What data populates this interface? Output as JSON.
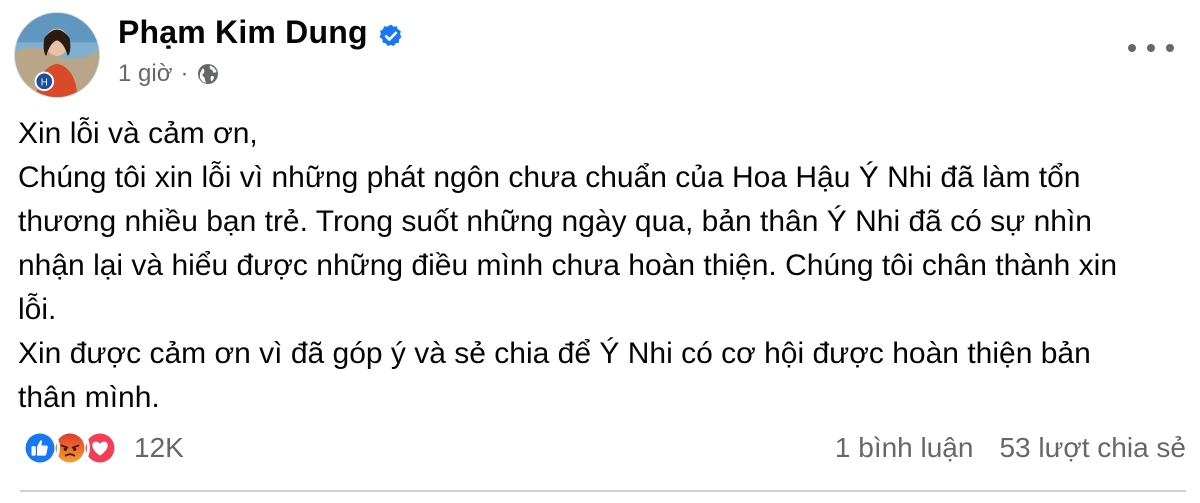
{
  "post": {
    "author_name": "Phạm Kim Dung",
    "time": "1 giờ",
    "separator": "·",
    "icons": {
      "verified": "verified-badge-icon",
      "privacy": "globe-icon",
      "more": "more-options-icon"
    },
    "text_lines": [
      "Xin lỗi và cảm ơn,",
      "Chúng tôi xin lỗi vì những phát ngôn chưa chuẩn của Hoa Hậu Ý Nhi đã làm tổn",
      "thương nhiều bạn trẻ. Trong suốt những ngày qua, bản thân Ý Nhi đã có sự nhìn",
      "nhận lại và hiểu được những điều mình chưa hoàn thiện. Chúng tôi chân thành xin",
      "lỗi.",
      "Xin được cảm ơn vì đã góp ý và sẻ chia để Ý Nhi có cơ hội được hoàn thiện bản",
      "thân mình."
    ]
  },
  "engagement": {
    "reactions": [
      "like",
      "angry",
      "love"
    ],
    "reaction_count": "12K",
    "comments": "1 bình luận",
    "shares": "53 lượt chia sẻ"
  },
  "colors": {
    "text": "#050505",
    "secondary": "#65676b",
    "like_blue": "#1877f2",
    "love_red": "#f33e58",
    "angry_orange": "#e9710f",
    "divider": "#ced0d4"
  }
}
